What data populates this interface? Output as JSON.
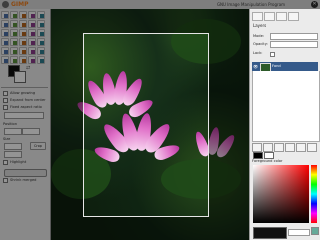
{
  "app": {
    "name": "GIMP",
    "window_title": "GNU Image Manipulation Program",
    "close_glyph": "✕"
  },
  "toolbox": {
    "tools": [
      "rect-select",
      "ellipse-select",
      "free-select",
      "fuzzy-select",
      "color-select",
      "scissors",
      "foreground-select",
      "paths",
      "color-picker",
      "zoom",
      "measure",
      "move",
      "align",
      "crop",
      "rotate",
      "scale",
      "shear",
      "perspective",
      "flip",
      "text",
      "bucket-fill",
      "blend",
      "pencil",
      "paintbrush",
      "eraser",
      "airbrush",
      "ink",
      "clone",
      "heal",
      "smudge"
    ],
    "swap_glyph": "⇄",
    "options": {
      "rows": [
        "Allow growing",
        "Expand from center",
        "Fixed aspect ratio",
        "Current",
        "Position",
        "Size",
        "Highlight",
        "Auto shrink",
        "Shrink merged"
      ],
      "button_label": "Crop"
    }
  },
  "canvas": {
    "image_description_icon": "water-lily-photo"
  },
  "dock": {
    "title": "Layers",
    "mode_label": "Mode:",
    "mode_value": "Normal",
    "opacity_label": "Opacity:",
    "lock_label": "Lock:",
    "layer": {
      "eye": "👁",
      "name": "Fond"
    },
    "palette_title": "Foreground color",
    "hex_value": "000000"
  }
}
